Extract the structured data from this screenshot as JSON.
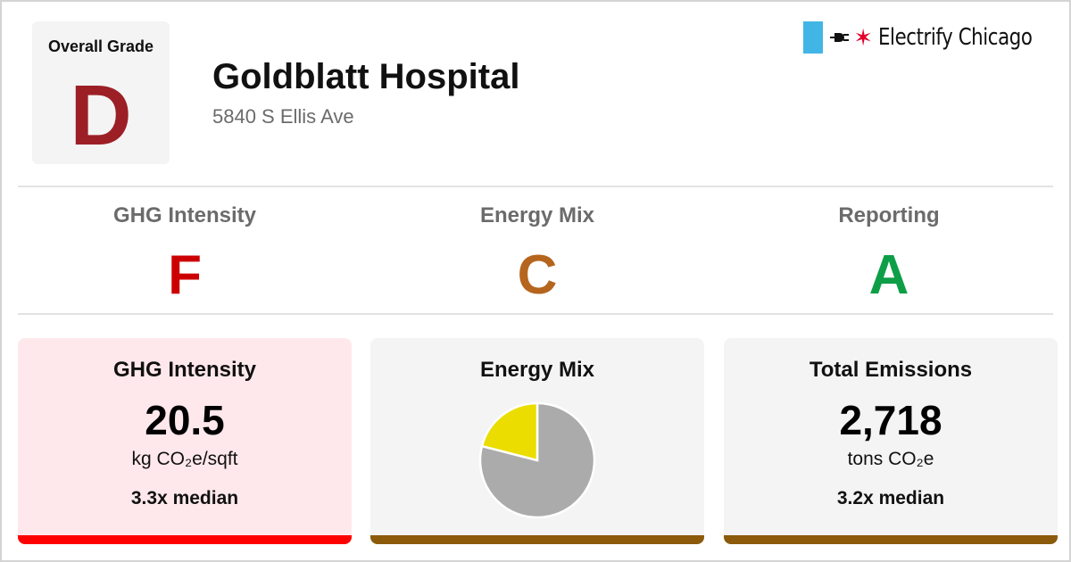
{
  "overall": {
    "label": "Overall Grade",
    "grade": "D",
    "color": "#9c1f26"
  },
  "building": {
    "name": "Goldblatt Hospital",
    "address": "5840 S Ellis Ave"
  },
  "brand": {
    "name": "Electrify Chicago",
    "accent_blue": "#41b6e6",
    "star_color": "#e4002b",
    "icons": [
      "plug-icon",
      "star-icon"
    ]
  },
  "subgrades": [
    {
      "title": "GHG Intensity",
      "grade": "F",
      "color": "#cc0000"
    },
    {
      "title": "Energy Mix",
      "grade": "C",
      "color": "#b5651d"
    },
    {
      "title": "Reporting",
      "grade": "A",
      "color": "#0e9e48"
    }
  ],
  "cards": {
    "ghg": {
      "title": "GHG Intensity",
      "value": "20.5",
      "unit": "kg CO₂e/sqft",
      "median": "3.3x median",
      "bg": "#ffe8ec",
      "bar_color": "#ff0000"
    },
    "mix": {
      "title": "Energy Mix",
      "bar_color": "#8b5a0b"
    },
    "total": {
      "title": "Total Emissions",
      "value": "2,718",
      "unit": "tons CO₂e",
      "median": "3.2x median",
      "bar_color": "#8b5a0b"
    }
  },
  "chart_data": {
    "type": "pie",
    "title": "Energy Mix",
    "slices": [
      {
        "value": 0.79,
        "color": "#ababab"
      },
      {
        "value": 0.21,
        "color": "#ebdd00"
      }
    ]
  }
}
